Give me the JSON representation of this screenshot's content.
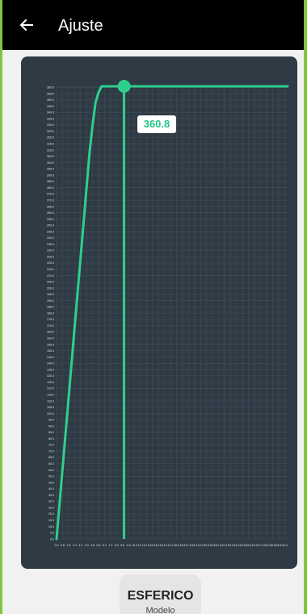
{
  "appbar": {
    "title": "Ajuste",
    "back_icon": "arrow-left-icon"
  },
  "tooltip": {
    "value": "360.8"
  },
  "model": {
    "name": "ESFERICO",
    "label": "Modelo"
  },
  "colors": {
    "line": "#2ecf8e",
    "card": "#2e3a44",
    "grid": "#44525d",
    "appbar": "#000000",
    "background": "#f1f1f1"
  },
  "chart_data": {
    "type": "line",
    "title": "",
    "xlabel": "",
    "ylabel": "",
    "xlim": [
      0.0,
      30.8
    ],
    "ylim": [
      0.0,
      360.8
    ],
    "y_tick_step": 5,
    "x_tick_step": 0.8,
    "grid": true,
    "series": [
      {
        "x": [
          0.0,
          0.4,
          0.8,
          1.2,
          1.6,
          2.0,
          2.4,
          2.8,
          3.2,
          3.6,
          4.0,
          4.4,
          4.8,
          5.2,
          5.6,
          6.0,
          30.8
        ],
        "y": [
          0.0,
          28.0,
          56.0,
          84.0,
          112.0,
          140.0,
          168.0,
          196.0,
          224.0,
          252.0,
          280.0,
          308.0,
          330.0,
          348.0,
          356.0,
          360.8,
          360.8
        ]
      }
    ],
    "highlight": {
      "x": 9.0,
      "y": 360.8,
      "label": "360.8"
    }
  }
}
